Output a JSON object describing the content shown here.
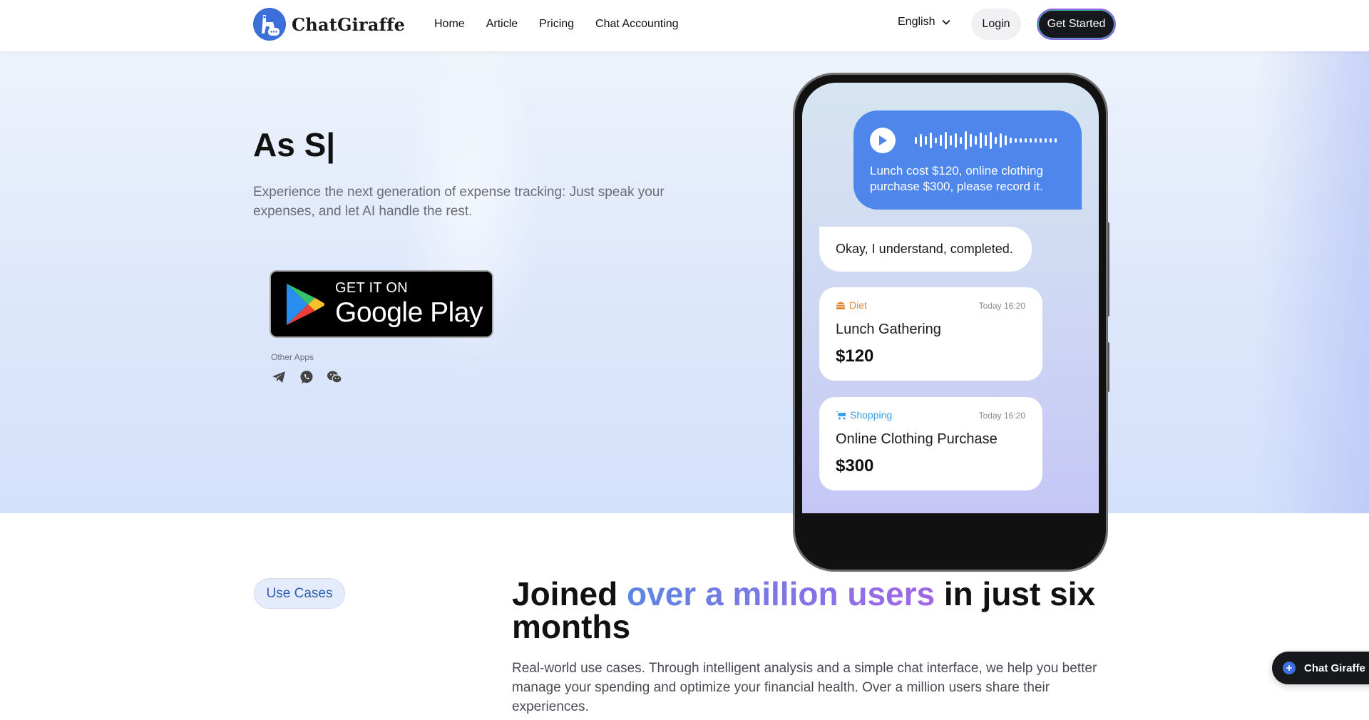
{
  "header": {
    "brand": "ChatGiraffe",
    "nav": [
      "Home",
      "Article",
      "Pricing",
      "Chat Accounting"
    ],
    "language": "English",
    "login_label": "Login",
    "get_started_label": "Get Started"
  },
  "hero": {
    "title": "As S|",
    "description": "Experience the next generation of expense tracking: Just speak your expenses, and let AI handle the rest.",
    "store_badge": {
      "small": "GET IT ON",
      "big": "Google Play"
    },
    "other_apps_label": "Other Apps",
    "other_apps_icons": [
      "telegram-icon",
      "whatsapp-icon",
      "wechat-icon"
    ]
  },
  "phone": {
    "voice_message": "Lunch cost $120, online clothing purchase $300, please record it.",
    "reply": "Okay, I understand, completed.",
    "cards": [
      {
        "category": "Diet",
        "category_color": "#e58a3c",
        "time": "Today 16:20",
        "name": "Lunch Gathering",
        "amount": "$120"
      },
      {
        "category": "Shopping",
        "category_color": "#3a9fe6",
        "time": "Today 16:20",
        "name": "Online Clothing Purchase",
        "amount": "$300"
      }
    ]
  },
  "use_cases": {
    "pill": "Use Cases",
    "title_before": "Joined ",
    "title_highlight": "over a million users",
    "title_after": " in just six months",
    "description": "Real-world use cases. Through intelligent analysis and a simple chat interface, we help you better manage your spending and optimize your financial health. Over a million users share their experiences."
  },
  "chat_widget": {
    "label": "Chat Giraffe"
  },
  "colors": {
    "accent_blue": "#4e86ec",
    "gradient_start": "#5c86e4",
    "gradient_end": "#a265e8",
    "dark_button": "#16181d"
  }
}
